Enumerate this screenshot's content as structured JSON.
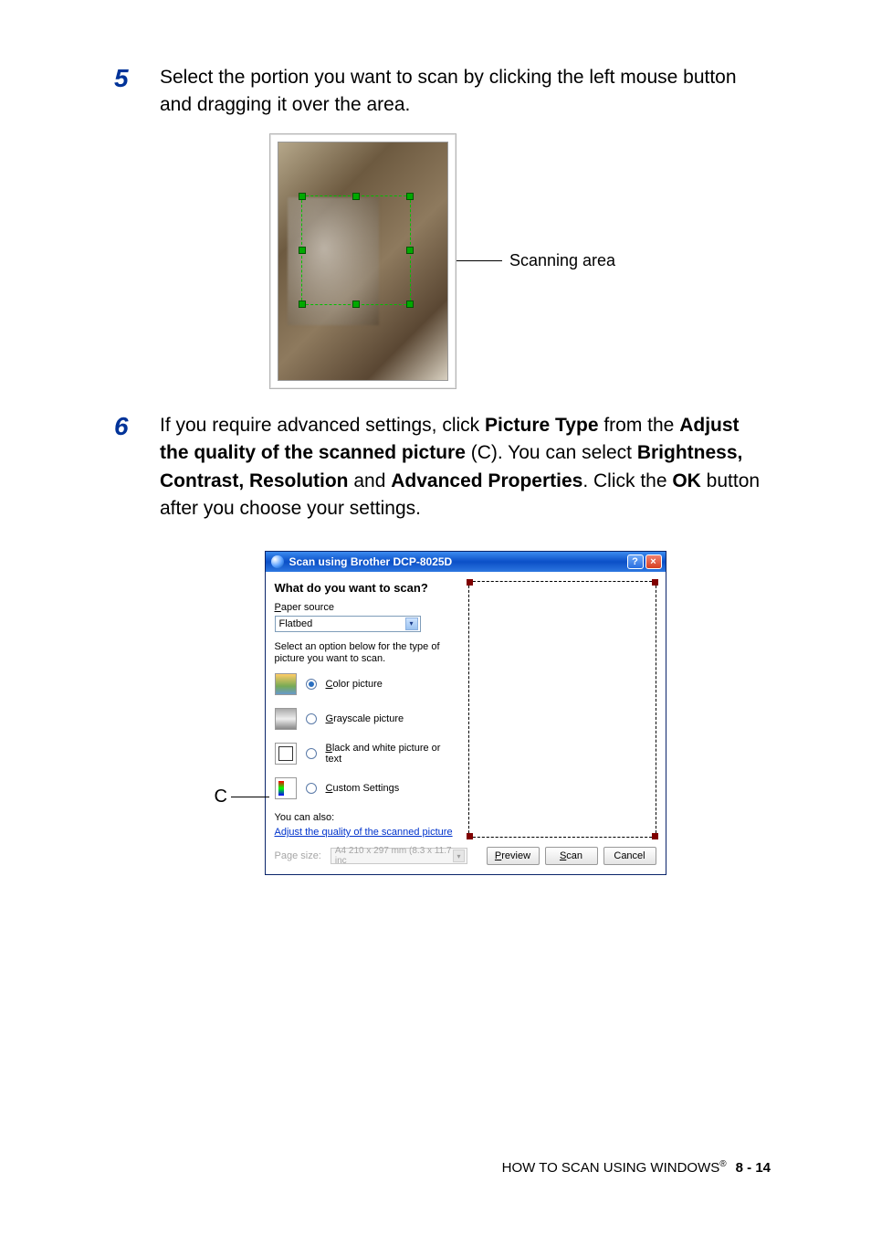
{
  "step5": {
    "number": "5",
    "text": "Select the portion you want to scan by clicking the left mouse button and dragging it over the area."
  },
  "fig1": {
    "callout": "Scanning area"
  },
  "step6": {
    "number": "6",
    "text_a": "If you require advanced settings, click ",
    "bold_a": "Picture Type",
    "text_b": " from the ",
    "bold_b": "Adjust the quality of the scanned picture",
    "text_c": " (C). You can select ",
    "bold_c": "Brightness, Contrast, Resolution",
    "text_d": " and ",
    "bold_d": "Advanced Properties",
    "text_e": ". Click the ",
    "bold_e": "OK",
    "text_f": " button after you choose your settings."
  },
  "c_marker": "C",
  "dialog": {
    "title": "Scan using Brother DCP-8025D",
    "heading": "What do you want to scan?",
    "paper_source_label": "Paper source",
    "paper_source_value": "Flatbed",
    "prompt": "Select an option below for the type of picture you want to scan.",
    "options": {
      "color": {
        "u": "C",
        "rest": "olor picture"
      },
      "gray": {
        "u": "G",
        "rest": "rayscale picture"
      },
      "bw": {
        "u": "B",
        "rest": "lack and white picture or text"
      },
      "custom": {
        "u": "C",
        "rest": "ustom Settings"
      }
    },
    "you_can_also": "You can also:",
    "adjust_link": "Adjust the quality of the scanned picture",
    "page_size_label": "Page size:",
    "page_size_value": "A4 210 x 297 mm (8.3 x 11.7 inc",
    "buttons": {
      "preview": {
        "u": "P",
        "rest": "review"
      },
      "scan": {
        "u": "S",
        "rest": "can"
      },
      "cancel": {
        "text": "Cancel"
      }
    }
  },
  "footer": {
    "text": "HOW TO SCAN USING WINDOWS",
    "reg": "®",
    "page": "8 - 14"
  }
}
